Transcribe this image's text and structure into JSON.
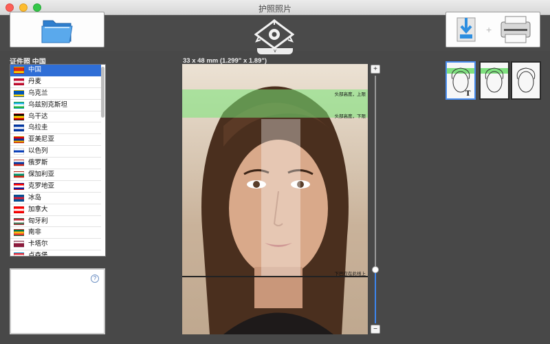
{
  "window": {
    "title": "护照照片"
  },
  "toolbar": {
    "move_dropdown_label": "v"
  },
  "left_panel": {
    "header": "证件照 中国",
    "countries": [
      {
        "name": "中国",
        "flag": [
          "#de2910",
          "#de2910",
          "#ffde00"
        ],
        "selected": true
      },
      {
        "name": "丹麦",
        "flag": [
          "#c60c30",
          "#ffffff",
          "#c60c30"
        ]
      },
      {
        "name": "乌克兰",
        "flag": [
          "#0057b7",
          "#0057b7",
          "#ffd700"
        ]
      },
      {
        "name": "乌兹别克斯坦",
        "flag": [
          "#1eb5e8",
          "#ffffff",
          "#1eb53a"
        ]
      },
      {
        "name": "乌干达",
        "flag": [
          "#000000",
          "#fcdc04",
          "#d90000"
        ]
      },
      {
        "name": "乌拉圭",
        "flag": [
          "#0038a8",
          "#ffffff",
          "#0038a8"
        ]
      },
      {
        "name": "亚美尼亚",
        "flag": [
          "#d90012",
          "#0033a0",
          "#f2a800"
        ]
      },
      {
        "name": "以色列",
        "flag": [
          "#ffffff",
          "#0038b8",
          "#ffffff"
        ]
      },
      {
        "name": "俄罗斯",
        "flag": [
          "#ffffff",
          "#0039a6",
          "#d52b1e"
        ]
      },
      {
        "name": "保加利亚",
        "flag": [
          "#ffffff",
          "#00966e",
          "#d62612"
        ]
      },
      {
        "name": "克罗地亚",
        "flag": [
          "#ff0000",
          "#ffffff",
          "#171796"
        ]
      },
      {
        "name": "冰岛",
        "flag": [
          "#02529c",
          "#dc1e35",
          "#02529c"
        ]
      },
      {
        "name": "加拿大",
        "flag": [
          "#ff0000",
          "#ffffff",
          "#ff0000"
        ]
      },
      {
        "name": "匈牙利",
        "flag": [
          "#ce2939",
          "#ffffff",
          "#477050"
        ]
      },
      {
        "name": "南非",
        "flag": [
          "#007749",
          "#ffb612",
          "#de3831"
        ]
      },
      {
        "name": "卡塔尔",
        "flag": [
          "#ffffff",
          "#8d1b3d",
          "#8d1b3d"
        ]
      },
      {
        "name": "卢森堡",
        "flag": [
          "#ef3340",
          "#ffffff",
          "#00a3e0"
        ]
      }
    ]
  },
  "photo": {
    "size_label": "33 x 48 mm (1.299\" x 1.89\")",
    "guides": {
      "head_top_upper": "头部高度，上限",
      "head_top_lower": "头部高度，下限",
      "chin_line": "下巴应在此线上"
    }
  },
  "zoom": {
    "plus": "+",
    "minus": "−",
    "level": 0.16
  },
  "info": {
    "help_label": "?"
  },
  "colors": {
    "accent": "#2f6ed6",
    "guide_green": "#78e678",
    "slider_blue": "#3c86f0"
  }
}
